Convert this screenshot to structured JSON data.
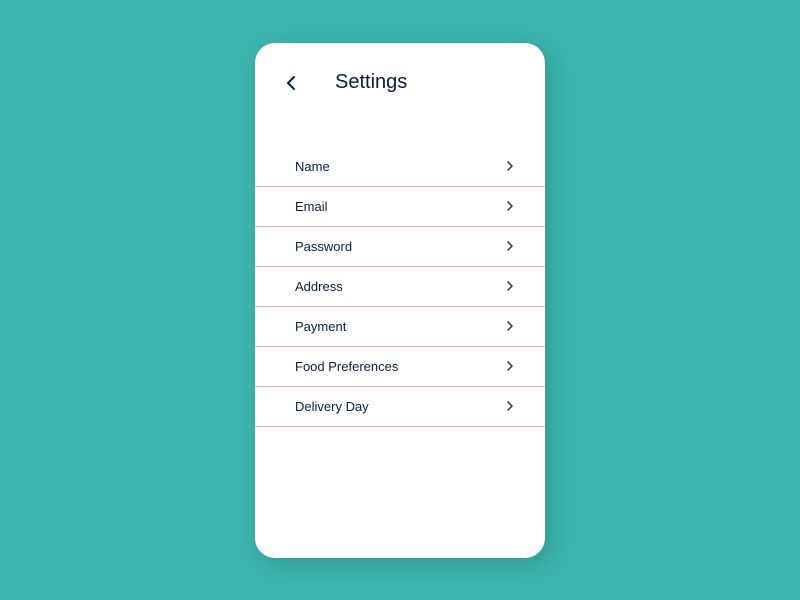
{
  "header": {
    "title": "Settings"
  },
  "menu": {
    "items": [
      {
        "label": "Name"
      },
      {
        "label": "Email"
      },
      {
        "label": "Password"
      },
      {
        "label": "Address"
      },
      {
        "label": "Payment"
      },
      {
        "label": "Food Preferences"
      },
      {
        "label": "Delivery Day"
      }
    ]
  }
}
